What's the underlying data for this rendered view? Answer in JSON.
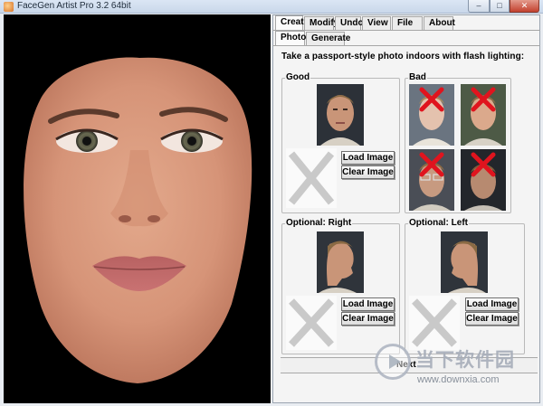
{
  "window": {
    "title": "FaceGen Artist Pro 3.2 64bit",
    "controls": {
      "minimize": "–",
      "maximize": "□",
      "close": "✕"
    }
  },
  "main_tabs": [
    "Create",
    "Modify",
    "Undo",
    "View",
    "File",
    "About"
  ],
  "sub_tabs": [
    "Photo",
    "Generate"
  ],
  "instruction": "Take a passport-style photo indoors with flash lighting:",
  "groups": {
    "good": {
      "title": "Good",
      "load": "Load Image",
      "clear": "Clear Image"
    },
    "bad": {
      "title": "Bad"
    },
    "right": {
      "title": "Optional: Right",
      "load": "Load Image",
      "clear": "Clear Image"
    },
    "left": {
      "title": "Optional: Left",
      "load": "Load Image",
      "clear": "Clear Image"
    }
  },
  "next_label": "Next",
  "watermark": {
    "text": "当下软件园",
    "url": "www.downxia.com"
  },
  "colors": {
    "viewport_bg": "#000000",
    "reject_mark": "#e0141e",
    "placeholder_x": "#c9c9c9"
  },
  "icons": [
    "face-model",
    "portrait-photo",
    "profile-photo",
    "placeholder-x-icon",
    "reject-x-icon"
  ]
}
